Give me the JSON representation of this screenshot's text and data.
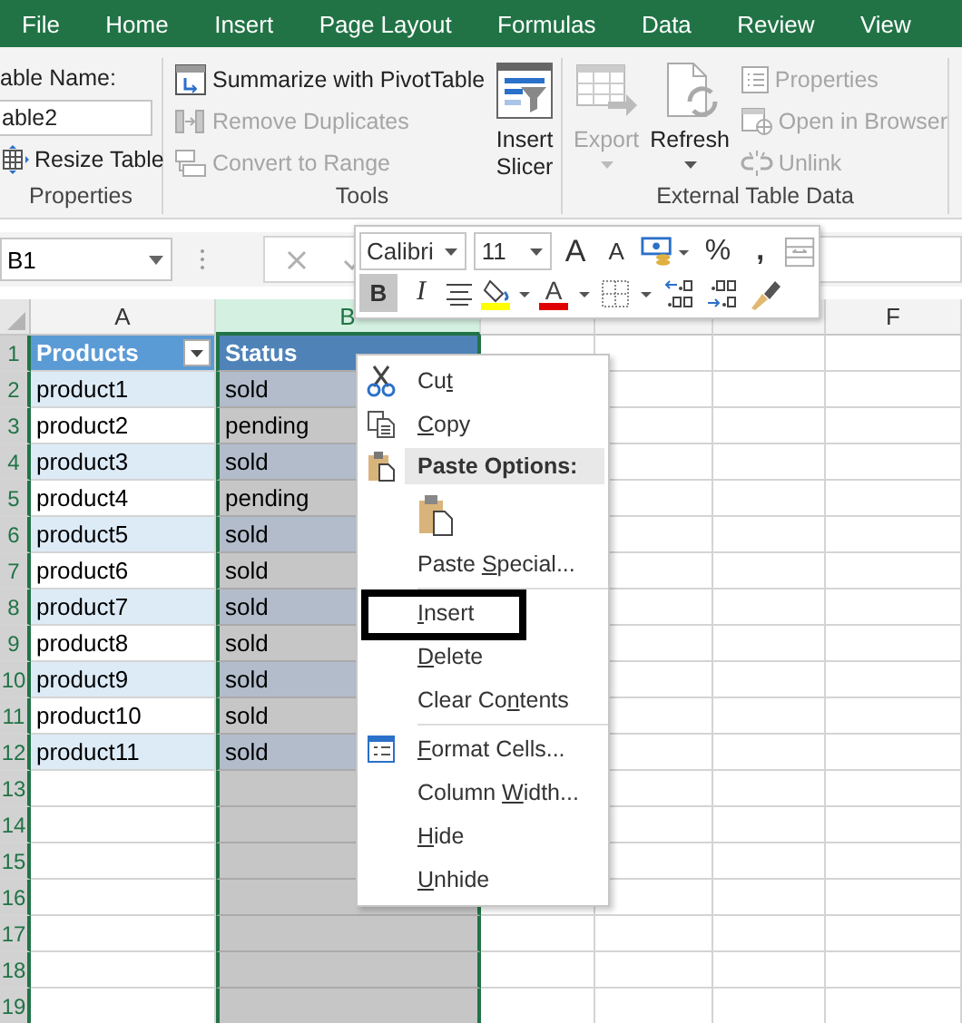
{
  "menu_tabs": [
    "File",
    "Home",
    "Insert",
    "Page Layout",
    "Formulas",
    "Data",
    "Review",
    "View"
  ],
  "ribbon": {
    "groups": [
      {
        "label": "Properties",
        "items": [
          {
            "kind": "stack",
            "items": [
              {
                "kind": "caption",
                "label": "able Name:"
              },
              {
                "kind": "field",
                "value": "able2"
              },
              {
                "kind": "small",
                "label": "Resize Table",
                "disabled": false
              }
            ]
          }
        ]
      },
      {
        "label": "Tools",
        "items": [
          {
            "kind": "stack",
            "items": [
              {
                "kind": "small",
                "label": "Summarize with PivotTable",
                "disabled": false
              },
              {
                "kind": "small",
                "label": "Remove Duplicates",
                "disabled": true
              },
              {
                "kind": "small",
                "label": "Convert to Range",
                "disabled": true
              }
            ]
          },
          {
            "kind": "large",
            "label": "Insert Slicer",
            "disabled": false,
            "dropdown": false
          }
        ]
      },
      {
        "label": "External Table Data",
        "items": [
          {
            "kind": "large",
            "label": "Export",
            "disabled": true,
            "dropdown": true
          },
          {
            "kind": "large",
            "label": "Refresh",
            "disabled": false,
            "dropdown": true
          },
          {
            "kind": "stack",
            "items": [
              {
                "kind": "small",
                "label": "Properties",
                "disabled": true
              },
              {
                "kind": "small",
                "label": "Open in Browser",
                "disabled": true
              },
              {
                "kind": "small",
                "label": "Unlink",
                "disabled": true
              }
            ]
          }
        ]
      }
    ]
  },
  "formula_bar": {
    "name_box": "B1"
  },
  "mini_toolbar": {
    "font": "Calibri",
    "size": "11",
    "grow_font": "A",
    "shrink_font": "A",
    "percent": "%",
    "comma": ",",
    "bold": {
      "label": "B",
      "on": true
    },
    "italic": {
      "label": "I",
      "on": false
    },
    "font_color": "A"
  },
  "sheet": {
    "columns": [
      {
        "label": "A",
        "selected": false
      },
      {
        "label": "B",
        "selected": true
      },
      {
        "selected": false
      },
      {
        "selected": false
      },
      {
        "selected": false
      },
      {
        "label": "F",
        "selected": false
      }
    ],
    "row_numbers": [
      "1",
      "2",
      "3",
      "4",
      "5",
      "6",
      "7",
      "8",
      "9",
      "10",
      "11",
      "12",
      "13",
      "14",
      "15",
      "16",
      "17",
      "18",
      "19"
    ],
    "table": {
      "header": [
        "Products",
        "Status"
      ],
      "rows": [
        [
          "product1",
          "sold"
        ],
        [
          "product2",
          "pending"
        ],
        [
          "product3",
          "sold"
        ],
        [
          "product4",
          "pending"
        ],
        [
          "product5",
          "sold"
        ],
        [
          "product6",
          "sold"
        ],
        [
          "product7",
          "sold"
        ],
        [
          "product8",
          "sold"
        ],
        [
          "product9",
          "sold"
        ],
        [
          "product10",
          "sold"
        ],
        [
          "product11",
          "sold"
        ]
      ]
    }
  },
  "context_menu": {
    "items": [
      {
        "kind": "command",
        "pre": "Cu",
        "key": "t",
        "outlined": false
      },
      {
        "kind": "command",
        "key": "C",
        "post": "opy",
        "outlined": false
      },
      {
        "kind": "header",
        "label": "Paste Options:"
      },
      {
        "kind": "paste-option"
      },
      {
        "kind": "command",
        "pre": "Paste ",
        "key": "S",
        "post": "pecial...",
        "outlined": false
      },
      {
        "kind": "separator"
      },
      {
        "kind": "command",
        "key": "I",
        "post": "nsert",
        "outlined": true
      },
      {
        "kind": "command",
        "key": "D",
        "post": "elete",
        "outlined": false
      },
      {
        "kind": "command",
        "pre": "Clear Co",
        "key": "n",
        "post": "tents",
        "outlined": false
      },
      {
        "kind": "separator"
      },
      {
        "kind": "command",
        "key": "F",
        "post": "ormat Cells...",
        "outlined": false
      },
      {
        "kind": "command",
        "pre": "Column ",
        "key": "W",
        "post": "idth...",
        "outlined": false
      },
      {
        "kind": "command",
        "key": "H",
        "post": "ide",
        "outlined": false
      },
      {
        "kind": "command",
        "key": "U",
        "post": "nhide",
        "outlined": false
      }
    ]
  }
}
